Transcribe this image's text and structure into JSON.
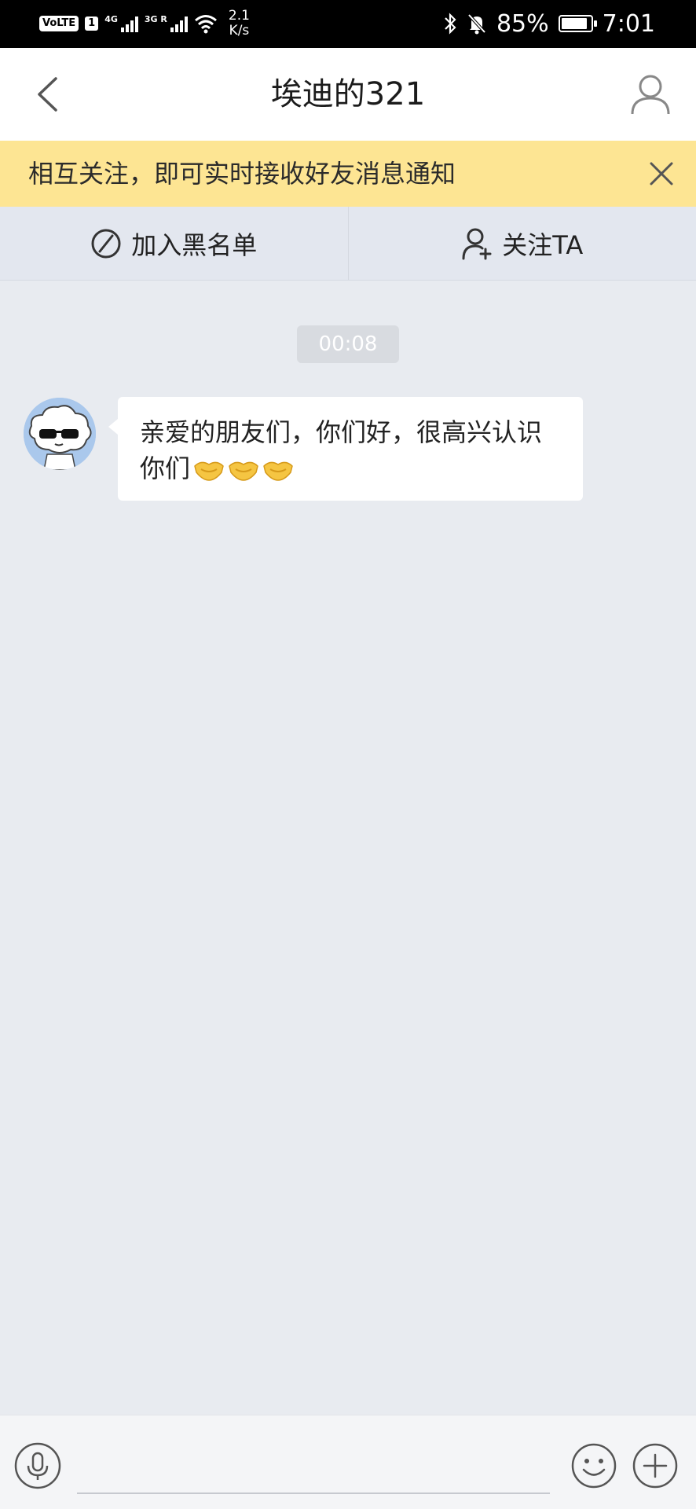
{
  "status_bar": {
    "volte": "VoLTE",
    "sim": "1",
    "net1": "4G",
    "net2": "3G R",
    "speed_value": "2.1",
    "speed_unit": "K/s",
    "battery": "85%",
    "time": "7:01"
  },
  "header": {
    "title": "埃迪的321",
    "back_icon": "chevron-left-icon",
    "profile_icon": "user-icon"
  },
  "notice": {
    "text": "相互关注，即可实时接收好友消息通知",
    "close_icon": "close-icon"
  },
  "actions": {
    "blacklist_label": "加入黑名单",
    "blacklist_icon": "block-icon",
    "follow_label": "关注TA",
    "follow_icon": "user-plus-icon"
  },
  "chat": {
    "timestamp": "00:08",
    "messages": [
      {
        "text": "亲爱的朋友们，你们好，很高兴认识你们",
        "emojis": [
          "handshake-emoji",
          "handshake-emoji",
          "handshake-emoji"
        ]
      }
    ]
  },
  "input_bar": {
    "voice_icon": "microphone-icon",
    "input_value": "",
    "emoji_icon": "smiley-icon",
    "plus_icon": "plus-icon"
  },
  "colors": {
    "notice_bg": "#fde593",
    "chat_bg": "#e8ebf0",
    "action_bg": "#e3e7ef"
  }
}
